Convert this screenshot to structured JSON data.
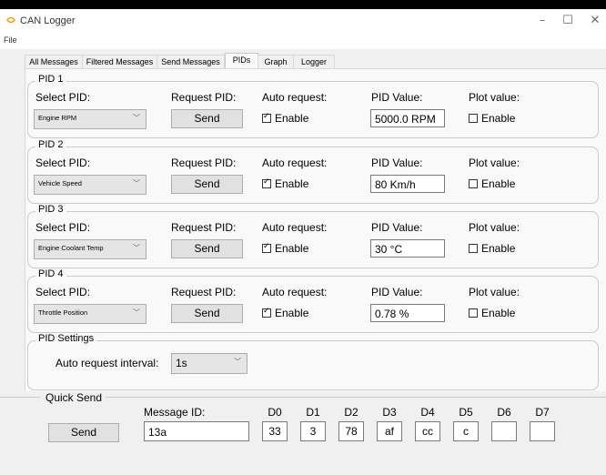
{
  "window": {
    "title": "CAN Logger",
    "controls": {
      "minimize": "–",
      "maximize": "☐",
      "close": "✕"
    }
  },
  "menu": {
    "file": "File"
  },
  "tabs": [
    {
      "label": "All Messages",
      "active": false
    },
    {
      "label": "Filtered Messages",
      "active": false
    },
    {
      "label": "Send Messages",
      "active": false
    },
    {
      "label": "PIDs",
      "active": true
    },
    {
      "label": "Graph",
      "active": false
    },
    {
      "label": "Logger",
      "active": false
    }
  ],
  "labels": {
    "select_pid": "Select PID:",
    "request_pid": "Request PID:",
    "auto_request": "Auto request:",
    "pid_value": "PID Value:",
    "plot_value": "Plot value:",
    "send": "Send",
    "enable": "Enable"
  },
  "pids": [
    {
      "title": "PID 1",
      "selected": "Engine RPM",
      "auto_request": true,
      "value": "5000.0 RPM",
      "plot": false
    },
    {
      "title": "PID 2",
      "selected": "Vehicle Speed",
      "auto_request": true,
      "value": "80 Km/h",
      "plot": false
    },
    {
      "title": "PID 3",
      "selected": "Engine Coolant Temp",
      "auto_request": true,
      "value": "30 °C",
      "plot": false
    },
    {
      "title": "PID 4",
      "selected": "Throttle Position",
      "auto_request": true,
      "value": "0.78 %",
      "plot": false
    }
  ],
  "pid_settings": {
    "title": "PID Settings",
    "interval_label": "Auto request interval:",
    "interval_value": "1s"
  },
  "quick_send": {
    "title": "Quick Send",
    "message_id_label": "Message ID:",
    "message_id": "13a",
    "send_label": "Send",
    "bytes": [
      {
        "label": "D0",
        "value": "33"
      },
      {
        "label": "D1",
        "value": "3"
      },
      {
        "label": "D2",
        "value": "78"
      },
      {
        "label": "D3",
        "value": "af"
      },
      {
        "label": "D4",
        "value": "cc"
      },
      {
        "label": "D5",
        "value": "c"
      },
      {
        "label": "D6",
        "value": ""
      },
      {
        "label": "D7",
        "value": ""
      }
    ]
  },
  "colors": {
    "app_icon": "#f0a020",
    "window_bg": "#f0f0f0",
    "panel_bg": "#f9f9f9"
  }
}
